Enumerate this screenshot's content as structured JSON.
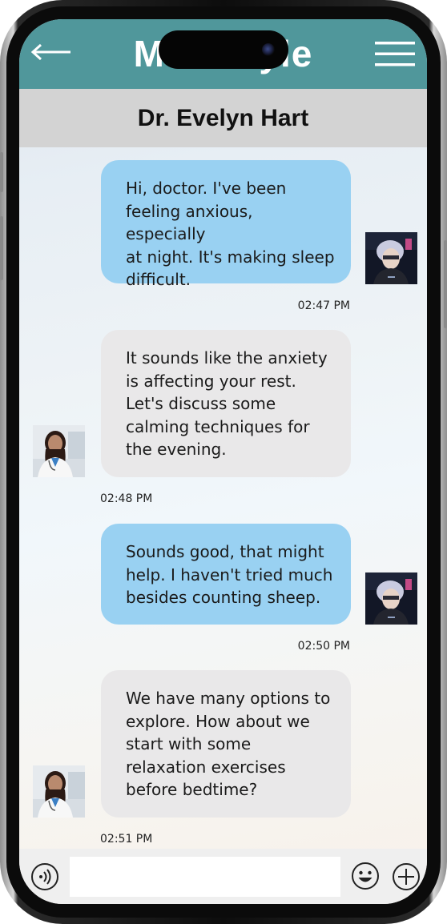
{
  "app": {
    "title": "MediStyle"
  },
  "header": {
    "contact_name": "Dr. Evelyn Hart",
    "back_icon": "arrow-left-icon",
    "menu_icon": "hamburger-menu-icon",
    "background_color": "#50979b"
  },
  "messages": [
    {
      "sender": "user",
      "text": "Hi, doctor. I've been\nfeeling anxious, especially\nat night. It's making sleep\ndifficult.",
      "time": "02:47 PM"
    },
    {
      "sender": "doctor",
      "text": "It sounds like the anxiety\nis affecting your rest.\nLet's discuss some\ncalming techniques for\nthe evening.",
      "time": "02:48 PM"
    },
    {
      "sender": "user",
      "text": "Sounds good, that might\nhelp. I haven't tried much\nbesides counting sheep.",
      "time": "02:50 PM"
    },
    {
      "sender": "doctor",
      "text": "We have many options to\nexplore. How about we\nstart with some\nrelaxation exercises\nbefore bedtime?",
      "time": "02:51 PM"
    }
  ],
  "input_bar": {
    "message_value": "",
    "voice_icon": "speaker-voice-icon",
    "emoji_icon": "smiley-face-icon",
    "add_icon": "plus-circle-icon"
  },
  "colors": {
    "sent_bubble": "#99d1f2",
    "received_bubble": "#e9e8e9",
    "subheader": "#d3d3d3"
  }
}
